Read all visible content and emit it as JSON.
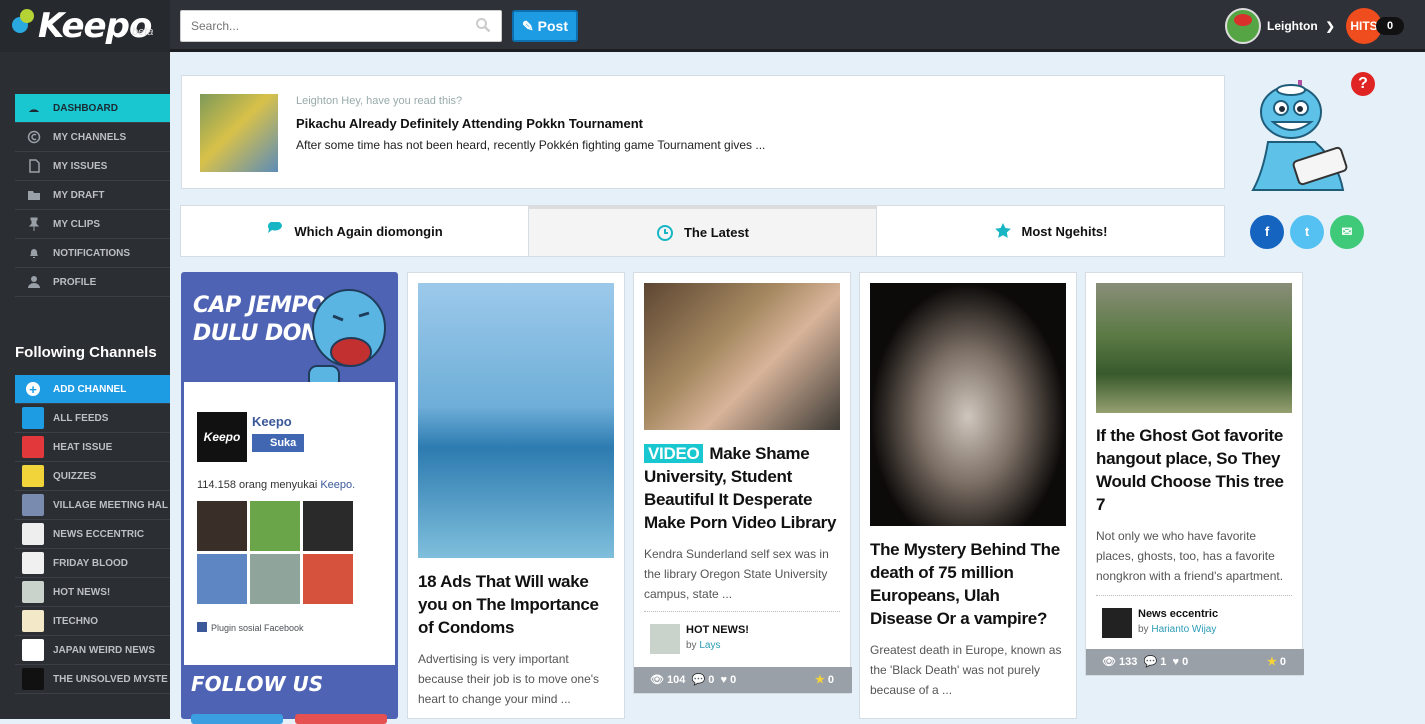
{
  "header": {
    "brand": "Keepo",
    "brand_suffix": "beta",
    "search_placeholder": "Search...",
    "post_label": "Post",
    "user_name": "Leighton",
    "hits_label": "HITS",
    "hits_count": "0"
  },
  "menu": [
    {
      "label": "DASHBOARD",
      "icon": "dashboard-icon",
      "active": true
    },
    {
      "label": "MY CHANNELS",
      "icon": "copyright-icon",
      "active": false
    },
    {
      "label": "MY ISSUES",
      "icon": "document-icon",
      "active": false
    },
    {
      "label": "MY DRAFT",
      "icon": "folder-icon",
      "active": false
    },
    {
      "label": "MY CLIPS",
      "icon": "pin-icon",
      "active": false
    },
    {
      "label": "NOTIFICATIONS",
      "icon": "bell-icon",
      "active": false
    },
    {
      "label": "PROFILE",
      "icon": "user-icon",
      "active": false
    }
  ],
  "following": {
    "title": "Following Channels",
    "items": [
      {
        "label": "ADD CHANNEL",
        "color": "#ffffff",
        "active": true
      },
      {
        "label": "ALL FEEDS",
        "color": "#1d9be3",
        "active": false
      },
      {
        "label": "HEAT ISSUE",
        "color": "#e2383b",
        "active": false
      },
      {
        "label": "QUIZZES",
        "color": "#f1d43a",
        "active": false
      },
      {
        "label": "VILLAGE MEETING HAL",
        "color": "#7a8bb0",
        "active": false
      },
      {
        "label": "NEWS ECCENTRIC",
        "color": "#eeeeee",
        "active": false
      },
      {
        "label": "FRIDAY BLOOD",
        "color": "#f0f0f0",
        "active": false
      },
      {
        "label": "HOT NEWS!",
        "color": "#c9d3cc",
        "active": false
      },
      {
        "label": "ITECHNO",
        "color": "#f3e9c9",
        "active": false
      },
      {
        "label": "JAPAN WEIRD NEWS",
        "color": "#ffffff",
        "active": false
      },
      {
        "label": "THE UNSOLVED MYSTE",
        "color": "#111111",
        "active": false
      }
    ]
  },
  "notification": {
    "who": "Leighton Hey, have you read this?",
    "title": "Pikachu Already Definitely Attending Pokkn Tournament",
    "excerpt": "After some time has not been heard, recently Pokkén fighting game Tournament gives ..."
  },
  "tabs": [
    {
      "label": "Which Again diomongin",
      "icon": "speech-bubble-icon",
      "active": false
    },
    {
      "label": "The Latest",
      "icon": "clock-icon",
      "active": true
    },
    {
      "label": "Most Ngehits!",
      "icon": "star-icon",
      "active": false
    }
  ],
  "share": [
    {
      "label": "f",
      "color": "#1565c0"
    },
    {
      "label": "t",
      "color": "#55c1f2"
    },
    {
      "label": "✉",
      "color": "#3fca7a"
    }
  ],
  "promo": {
    "headline_1": "CAP JEMPOL",
    "headline_2": "DULU DONG!",
    "fb_page": "Keepo",
    "logo_text": "Keepo",
    "like_label": "Suka",
    "like_count": "114.158 orang menyukai",
    "like_page": "Keepo.",
    "plugin": "Plugin sosial Facebook",
    "follow": "FOLLOW US"
  },
  "cards": [
    {
      "tag": "",
      "title": "18 Ads That Will wake you on The Importance of Condoms",
      "excerpt": "Advertising is very important because their job is to move one's heart to change your mind ..."
    },
    {
      "tag": "VIDEO",
      "title": "Make Shame University, Student Beautiful It Desperate Make Porn Video Library",
      "excerpt": "Kendra Sunderland self sex was in the library Oregon State University campus, state ...",
      "source": "HOT NEWS!",
      "by_label": "by",
      "author": "Lays",
      "views": "104",
      "comments": "0",
      "likes": "0",
      "stars": "0"
    },
    {
      "tag": "",
      "title": "The Mystery Behind The death of 75 million Europeans, Ulah Disease Or a vampire?",
      "excerpt": "Greatest death in Europe, known as the 'Black Death' was not purely because of a ..."
    },
    {
      "tag": "",
      "title": "If the Ghost Got favorite hangout place, So They Would Choose This tree 7",
      "excerpt": "Not only we who have favorite places, ghosts, too, has a favorite nongkron with a friend's apartment.",
      "source": "News eccentric",
      "by_label": "by",
      "author": "Harianto Wijay",
      "views": "133",
      "comments": "1",
      "likes": "0",
      "stars": "0"
    }
  ]
}
